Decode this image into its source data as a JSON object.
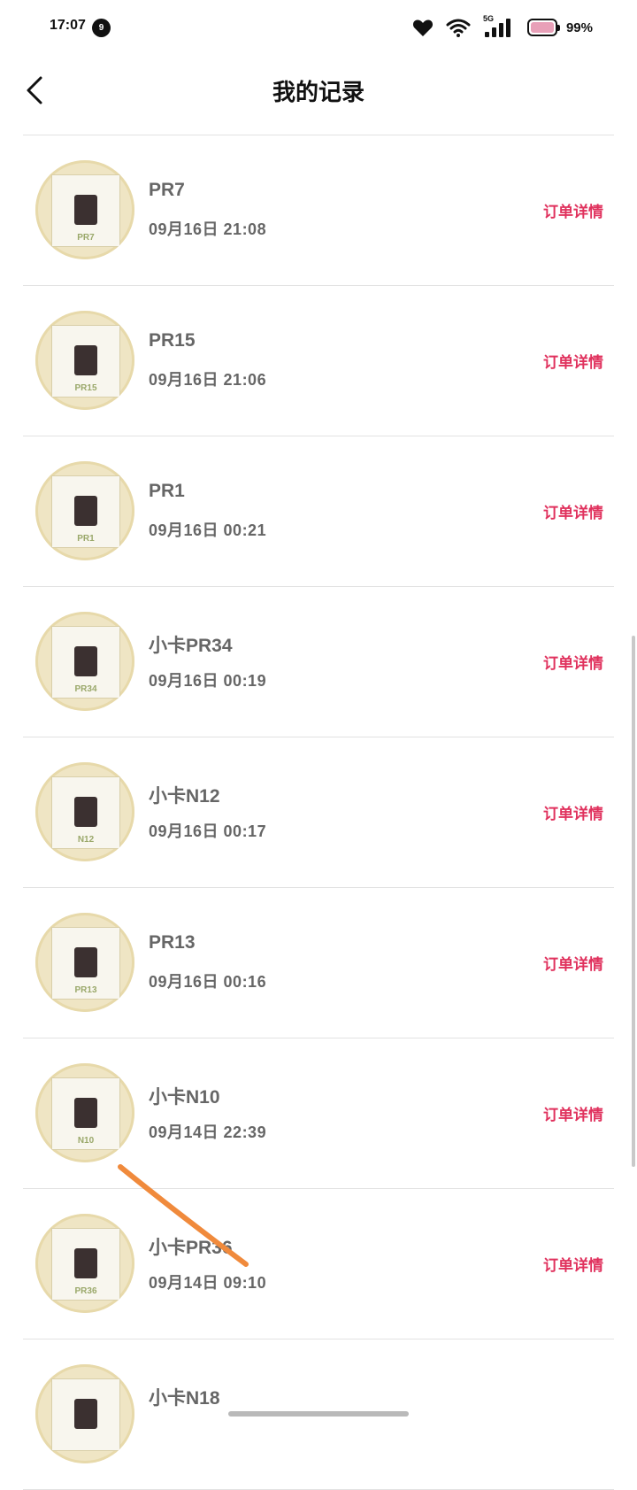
{
  "status_bar": {
    "time": "17:07",
    "notification_count": "9",
    "network": "5G",
    "battery_percent": "99%",
    "battery_level": 0.99,
    "battery_color": "#e8a0b8"
  },
  "header": {
    "title": "我的记录"
  },
  "records": [
    {
      "name": "PR7",
      "time": "09月16日  21:08",
      "detail_label": "订单详情",
      "thumb_label": "PR7"
    },
    {
      "name": "PR15",
      "time": "09月16日  21:06",
      "detail_label": "订单详情",
      "thumb_label": "PR15"
    },
    {
      "name": "PR1",
      "time": "09月16日  00:21",
      "detail_label": "订单详情",
      "thumb_label": "PR1"
    },
    {
      "name": "小卡PR34",
      "time": "09月16日  00:19",
      "detail_label": "订单详情",
      "thumb_label": "PR34"
    },
    {
      "name": "小卡N12",
      "time": "09月16日  00:17",
      "detail_label": "订单详情",
      "thumb_label": "N12"
    },
    {
      "name": "PR13",
      "time": "09月16日  00:16",
      "detail_label": "订单详情",
      "thumb_label": "PR13"
    },
    {
      "name": "小卡N10",
      "time": "09月14日  22:39",
      "detail_label": "订单详情",
      "thumb_label": "N10"
    },
    {
      "name": "小卡PR36",
      "time": "09月14日  09:10",
      "detail_label": "订单详情",
      "thumb_label": "PR36"
    },
    {
      "name": "小卡N18",
      "time": "",
      "detail_label": "",
      "thumb_label": ""
    }
  ],
  "colors": {
    "accent": "#e0315d",
    "marker": "#f08a3c"
  }
}
